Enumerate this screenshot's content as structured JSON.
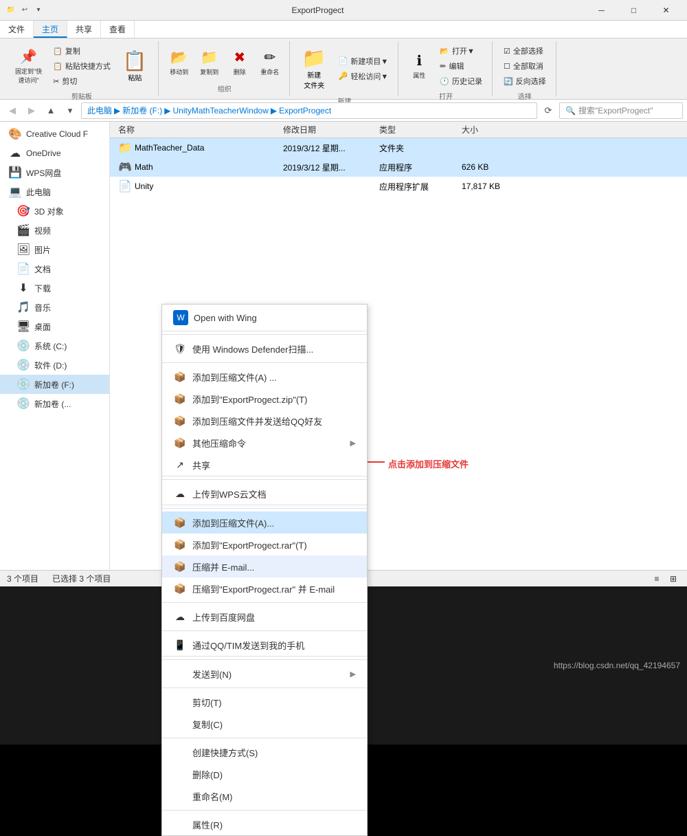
{
  "window": {
    "title": "ExportProgect",
    "controls": {
      "minimize": "─",
      "maximize": "□",
      "close": "✕"
    }
  },
  "titlebar": {
    "quick_icons": [
      "□",
      "↩",
      "⬇"
    ],
    "folder_icon": "📁"
  },
  "ribbon": {
    "tabs": [
      "文件",
      "主页",
      "共享",
      "查看"
    ],
    "active_tab": "主页",
    "groups": {
      "clipboard": {
        "label": "剪贴板",
        "pin_label": "固定到\"快\n速访问\"",
        "copy_label": "复制",
        "paste_label": "粘贴",
        "paste_shortcut_label": "粘贴快捷方式",
        "cut_label": "剪切"
      },
      "organize": {
        "label": "组织",
        "move_label": "移动到",
        "copy_label": "复制到",
        "delete_label": "删除",
        "rename_label": "重命名"
      },
      "new": {
        "label": "新建",
        "newfolder_label": "新建\n文件夹",
        "newitem_label": "新建项目▼",
        "easyaccess_label": "轻松访问▼"
      },
      "open": {
        "label": "打开",
        "open_label": "打开▼",
        "edit_label": "编辑",
        "history_label": "历史记录",
        "properties_label": "属性"
      },
      "select": {
        "label": "选择",
        "selectall_label": "全部选择",
        "selectnone_label": "全部取消",
        "invert_label": "反向选择"
      }
    }
  },
  "address_bar": {
    "path_parts": [
      "此电脑",
      "新加卷 (F:)",
      "UnityMathTeacherWindow",
      "ExportProgect"
    ],
    "search_placeholder": "搜索\"ExportProgect\""
  },
  "sidebar": {
    "items": [
      {
        "label": "Creative Cloud F",
        "icon": "🎨",
        "type": "item"
      },
      {
        "label": "OneDrive",
        "icon": "☁",
        "type": "item"
      },
      {
        "label": "WPS网盘",
        "icon": "💾",
        "type": "item"
      },
      {
        "label": "此电脑",
        "icon": "💻",
        "type": "section"
      },
      {
        "label": "3D 对象",
        "icon": "🎯",
        "type": "item",
        "indent": true
      },
      {
        "label": "视频",
        "icon": "🎬",
        "type": "item",
        "indent": true
      },
      {
        "label": "图片",
        "icon": "🖼",
        "type": "item",
        "indent": true
      },
      {
        "label": "文档",
        "icon": "📄",
        "type": "item",
        "indent": true
      },
      {
        "label": "下载",
        "icon": "⬇",
        "type": "item",
        "indent": true
      },
      {
        "label": "音乐",
        "icon": "🎵",
        "type": "item",
        "indent": true
      },
      {
        "label": "桌面",
        "icon": "🖥",
        "type": "item",
        "indent": true
      },
      {
        "label": "系统 (C:)",
        "icon": "💽",
        "type": "item",
        "indent": true
      },
      {
        "label": "软件 (D:)",
        "icon": "💽",
        "type": "item",
        "indent": true
      },
      {
        "label": "新加卷 (F:)",
        "icon": "💽",
        "type": "item",
        "indent": true,
        "selected": true
      },
      {
        "label": "新加卷 (...",
        "icon": "💽",
        "type": "item",
        "indent": true
      }
    ]
  },
  "file_list": {
    "columns": [
      "名称",
      "修改日期",
      "类型",
      "大小"
    ],
    "rows": [
      {
        "name": "MathTeacher_Data",
        "date": "2019/3/12 星期...",
        "type": "文件夹",
        "size": "",
        "icon": "📁",
        "color": "#ffc107",
        "selected": true
      },
      {
        "name": "Math",
        "date": "2019/3/12 星期...",
        "type": "应用程序",
        "size": "626 KB",
        "icon": "🎮",
        "selected": true
      },
      {
        "name": "Unity",
        "date": "",
        "type": "应用程序扩展",
        "size": "17,817 KB",
        "icon": "📄",
        "selected": false
      }
    ]
  },
  "status_bar": {
    "item_count": "3 个项目",
    "selected": "已选择 3 个项目"
  },
  "context_menu": {
    "items": [
      {
        "id": "open-wing",
        "label": "Open with Wing",
        "icon": "🪶",
        "type": "wing-header"
      },
      {
        "id": "defender",
        "label": "使用 Windows Defender扫描...",
        "icon": "🛡",
        "type": "item"
      },
      {
        "id": "add-zip-a",
        "label": "添加到压缩文件(A) ...",
        "icon": "📦",
        "type": "item"
      },
      {
        "id": "add-zip-t",
        "label": "添加到\"ExportProgect.zip\"(T)",
        "icon": "📦",
        "type": "item"
      },
      {
        "id": "add-zip-send-qq",
        "label": "添加到压缩文件并发送给QQ好友",
        "icon": "📦",
        "type": "item"
      },
      {
        "id": "other-compress",
        "label": "其他压缩命令",
        "icon": "📦",
        "type": "item",
        "arrow": true
      },
      {
        "id": "share",
        "label": "共享",
        "icon": "↗",
        "type": "item",
        "separator": true
      },
      {
        "id": "upload-wps",
        "label": "上传到WPS云文档",
        "icon": "☁",
        "type": "item",
        "separator": true
      },
      {
        "id": "add-rar-a",
        "label": "添加到压缩文件(A)...",
        "icon": "📦",
        "type": "item",
        "highlighted": true
      },
      {
        "id": "add-rar-t",
        "label": "添加到\"ExportProgect.rar\"(T)",
        "icon": "📦",
        "type": "item"
      },
      {
        "id": "compress-email",
        "label": "压缩并 E-mail...",
        "icon": "📦",
        "type": "item",
        "highlighted_light": true
      },
      {
        "id": "compress-rar-email",
        "label": "压缩到\"ExportProgect.rar\" 并 E-mail",
        "icon": "📦",
        "type": "item"
      },
      {
        "id": "upload-baidu",
        "label": "上传到百度网盘",
        "icon": "☁",
        "type": "item",
        "separator_before": true
      },
      {
        "id": "send-qq-phone",
        "label": "通过QQ/TIM发送到我的手机",
        "icon": "📱",
        "type": "item",
        "separator": true
      },
      {
        "id": "send-to",
        "label": "发送到(N)",
        "icon": "",
        "type": "item",
        "arrow": true,
        "separator": true
      },
      {
        "id": "cut",
        "label": "剪切(T)",
        "icon": "",
        "type": "item"
      },
      {
        "id": "copy",
        "label": "复制(C)",
        "icon": "",
        "type": "item",
        "separator": true
      },
      {
        "id": "create-shortcut",
        "label": "创建快捷方式(S)",
        "icon": "",
        "type": "item"
      },
      {
        "id": "delete",
        "label": "删除(D)",
        "icon": "",
        "type": "item"
      },
      {
        "id": "rename",
        "label": "重命名(M)",
        "icon": "",
        "type": "item",
        "separator": true
      },
      {
        "id": "properties",
        "label": "属性(R)",
        "icon": "",
        "type": "item"
      }
    ]
  },
  "annotation": {
    "text": "点击添加到压缩文件",
    "arrow_color": "#e53935"
  },
  "bottom": {
    "url": "https://blog.csdn.net/qq_42194657"
  }
}
